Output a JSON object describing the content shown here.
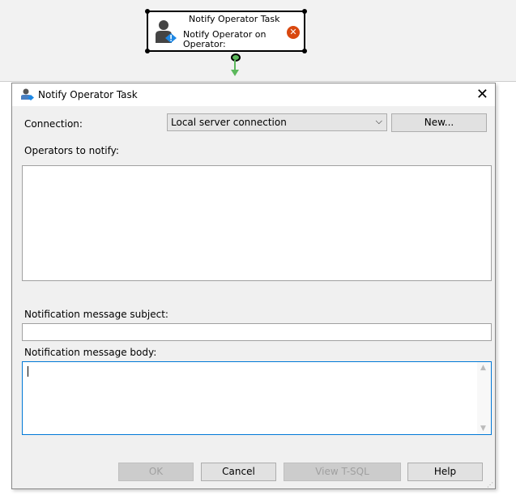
{
  "task_node": {
    "title": "Notify Operator Task",
    "description_line1": "Notify Operator on",
    "description_line2": "Operator:"
  },
  "dialog": {
    "title": "Notify Operator Task",
    "connection_label": "Connection:",
    "connection_value": "Local server connection",
    "new_button": "New...",
    "operators_label": "Operators to notify:",
    "subject_label": "Notification message subject:",
    "subject_value": "",
    "body_label": "Notification message body:",
    "body_value": "",
    "buttons": {
      "ok": "OK",
      "cancel": "Cancel",
      "view_tsql": "View T-SQL",
      "help": "Help"
    }
  }
}
